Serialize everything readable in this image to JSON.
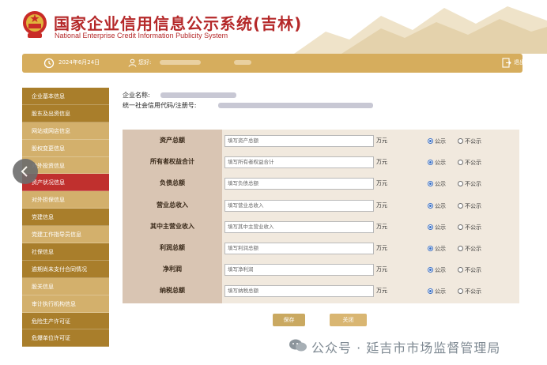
{
  "header": {
    "title_cn": "国家企业信用信息公示系统(吉林)",
    "title_en": "National Enterprise Credit Information Publicity System"
  },
  "topbar": {
    "date": "2024年6月24日",
    "greeting": "您好:",
    "logout": "退出登录"
  },
  "sidebar": {
    "items": [
      {
        "label": "企业基本信息",
        "style": "dark"
      },
      {
        "label": "股东及出资信息",
        "style": "dark"
      },
      {
        "label": "网站或网店信息",
        "style": "light"
      },
      {
        "label": "股权变更信息",
        "style": "light"
      },
      {
        "label": "对外投资信息",
        "style": "light"
      },
      {
        "label": "资产状况信息",
        "style": "active"
      },
      {
        "label": "对外担保信息",
        "style": "light"
      },
      {
        "label": "党建信息",
        "style": "dark"
      },
      {
        "label": "党建工作指导员信息",
        "style": "light"
      },
      {
        "label": "社保信息",
        "style": "dark"
      },
      {
        "label": "逾期尚未支付合同情况",
        "style": "dark"
      },
      {
        "label": "股关信息",
        "style": "light"
      },
      {
        "label": "审计执行机构信息",
        "style": "light"
      },
      {
        "label": "危险生产许可证",
        "style": "dark"
      },
      {
        "label": "危爆单位许可证",
        "style": "dark"
      }
    ]
  },
  "company": {
    "name_label": "企业名称:",
    "code_label": "统一社会信用代码/注册号:"
  },
  "form": {
    "unit": "万元",
    "public_label": "公示",
    "nonpublic_label": "不公示",
    "rows": [
      {
        "label": "资产总额",
        "placeholder": "填写资产总额"
      },
      {
        "label": "所有者权益合计",
        "placeholder": "填写所有者权益合计"
      },
      {
        "label": "负债总额",
        "placeholder": "填写负债总额"
      },
      {
        "label": "营业总收入",
        "placeholder": "填写营业总收入"
      },
      {
        "label": "其中主营业收入",
        "placeholder": "填写其中主营业收入"
      },
      {
        "label": "利润总额",
        "placeholder": "填写利润总额"
      },
      {
        "label": "净利润",
        "placeholder": "填写净利润"
      },
      {
        "label": "纳税总额",
        "placeholder": "填写纳税总额"
      }
    ]
  },
  "buttons": {
    "save": "保存",
    "close": "关闭"
  },
  "watermark": {
    "text": "公众号 · 延吉市市场监督管理局"
  },
  "colors": {
    "brand_red": "#b5292a",
    "gold": "#d6ad5d",
    "sidebar_dark": "#a97e2b",
    "sidebar_light": "#d3b06c",
    "sidebar_active": "#c0302e",
    "radio_blue": "#3a6fc4"
  },
  "icons": [
    "national-emblem-icon",
    "clock-icon",
    "user-icon",
    "logout-icon",
    "chevron-left-icon",
    "wechat-icon"
  ]
}
